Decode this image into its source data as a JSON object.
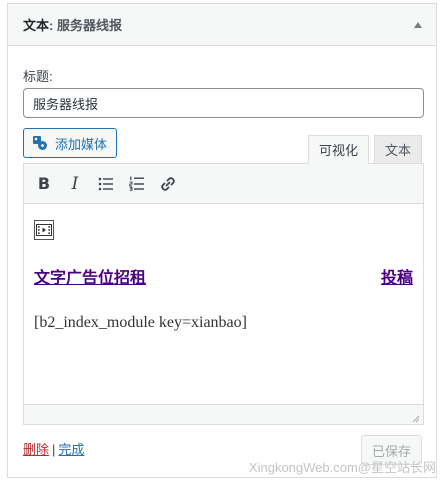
{
  "widget": {
    "title_prefix": "文本",
    "title_sep": ": ",
    "title_name": "服务器线报"
  },
  "form": {
    "title_label": "标题:",
    "title_value": "服务器线报"
  },
  "editor": {
    "add_media_label": "添加媒体",
    "tabs": [
      {
        "label": "可视化",
        "active": true
      },
      {
        "label": "文本",
        "active": false
      }
    ],
    "toolbar_icons": [
      "bold-icon",
      "italic-icon",
      "bullet-list-icon",
      "numbered-list-icon",
      "link-icon"
    ],
    "bold_glyph": "B",
    "italic_glyph": "I",
    "content": {
      "ad_link_left": "文字广告位招租",
      "ad_link_right": "投稿",
      "shortcode": "[b2_index_module key=xianbao]"
    }
  },
  "controls": {
    "delete_label": "删除",
    "separator": "|",
    "done_label": "完成",
    "saved_label": "已保存"
  },
  "watermark": "XingkongWeb.com@星空站长网",
  "colors": {
    "link_blue": "#2271b1",
    "delete_red": "#b32d2e",
    "visited_purple": "#4b0082"
  }
}
